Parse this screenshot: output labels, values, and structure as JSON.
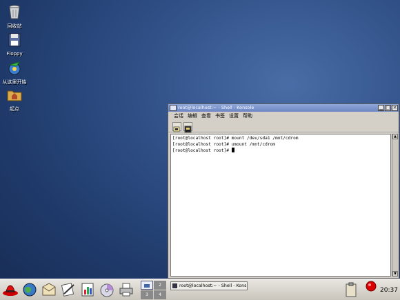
{
  "desktop": {
    "icons": [
      {
        "label": "回收站",
        "icon": "trash-icon"
      },
      {
        "label": "Floppy",
        "icon": "floppy-icon"
      },
      {
        "label": "从这里开始",
        "icon": "start-here-icon"
      },
      {
        "label": "起点",
        "icon": "home-folder-icon"
      }
    ]
  },
  "window": {
    "title": "root@localhost:~ - Shell - Konsole",
    "menu": [
      "会话",
      "编辑",
      "查看",
      "书签",
      "设置",
      "帮助"
    ],
    "terminal_lines": [
      "[root@localhost root]# mount /dev/sda1 /mnt/cdrom",
      "[root@localhost root]# umount /mnt/cdrom",
      "[root@localhost root]# "
    ]
  },
  "panel": {
    "pager": [
      "1",
      "2",
      "3",
      "4"
    ],
    "task_label": "root@localhost:~ - Shell - Kons",
    "clock": "20:37"
  },
  "colors": {
    "desktop": "#2f4f86",
    "titlebar": "#7a92cc",
    "panel": "#d6d3cc"
  }
}
